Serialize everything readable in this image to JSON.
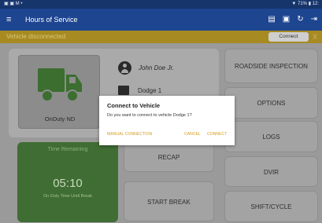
{
  "status_bar": {
    "left_text": "▣ ▣ M •",
    "right_text": "▼ 71% ▮ 12:"
  },
  "app_bar": {
    "menu_icon": "≡",
    "title": "Hours of Service",
    "icons": [
      "chat-icon",
      "user-card-icon",
      "refresh-icon",
      "logout-icon"
    ],
    "icon_glyphs": [
      "▤",
      "▣",
      "↻",
      "⇥"
    ]
  },
  "banner": {
    "message": "Vehicle disconnected",
    "connect_label": "Connect",
    "close_glyph": "X"
  },
  "status_panel": {
    "duty_status": "OnDuty ND",
    "driver_name": "John Doe Jr.",
    "vehicle_name": "Dodge 1"
  },
  "buttons": {
    "roadside": "ROADSIDE INSPECTION",
    "options": "OPTIONS",
    "logs": "LOGS",
    "recap": "RECAP",
    "dvir": "DVIR",
    "start_break": "START BREAK",
    "shift_cycle": "SHIFT/CYCLE"
  },
  "timer": {
    "label": "Time Remaining",
    "value": "05:10",
    "sublabel": "On Duty Time Until Break"
  },
  "dialog": {
    "title": "Connect to Vehicle",
    "message": "Do you want to connect to vehicle Dodge 1?",
    "manual_label": "MANUAL CONNECTION",
    "cancel_label": "CANCEL",
    "connect_label": "CONNECT"
  },
  "colors": {
    "app_bar": "#1d4590",
    "banner": "#a88a22",
    "timer_bg": "#3f6d33",
    "truck": "#3b6e2f",
    "accent": "#d39a16"
  }
}
